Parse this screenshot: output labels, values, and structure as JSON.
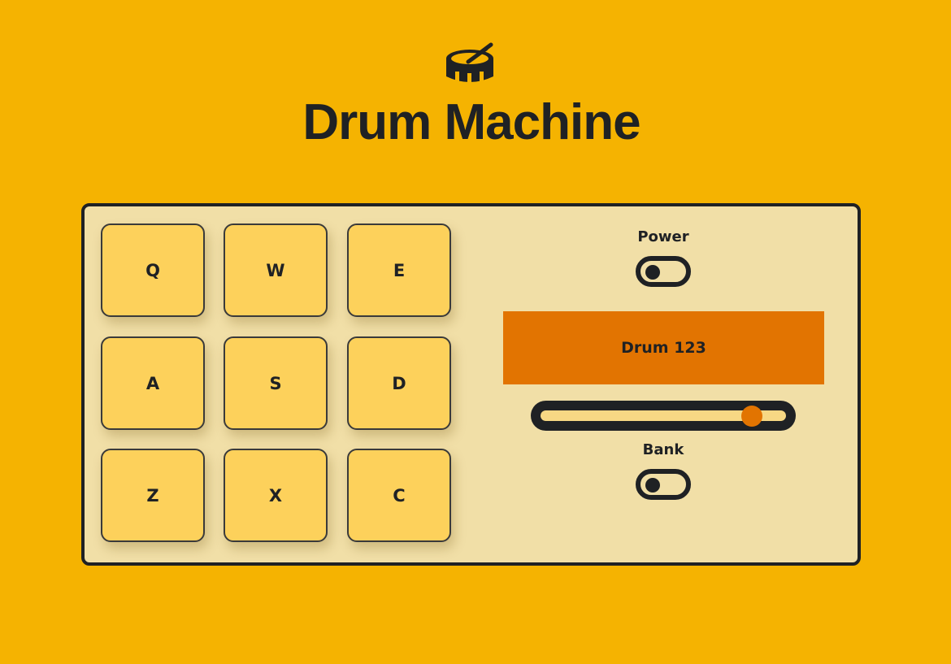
{
  "header": {
    "icon": "drum-icon",
    "title": "Drum Machine"
  },
  "pads": [
    {
      "key": "Q"
    },
    {
      "key": "W"
    },
    {
      "key": "E"
    },
    {
      "key": "A"
    },
    {
      "key": "S"
    },
    {
      "key": "D"
    },
    {
      "key": "Z"
    },
    {
      "key": "X"
    },
    {
      "key": "C"
    }
  ],
  "controls": {
    "power": {
      "label": "Power",
      "on": false
    },
    "display": {
      "text": "Drum 123"
    },
    "volume": {
      "value": 0.86
    },
    "bank": {
      "label": "Bank",
      "on": false
    }
  },
  "colors": {
    "background": "#f5b301",
    "panel": "#f1dfa7",
    "pad": "#fdd15b",
    "accent": "#e27401",
    "dark": "#1f2124"
  }
}
